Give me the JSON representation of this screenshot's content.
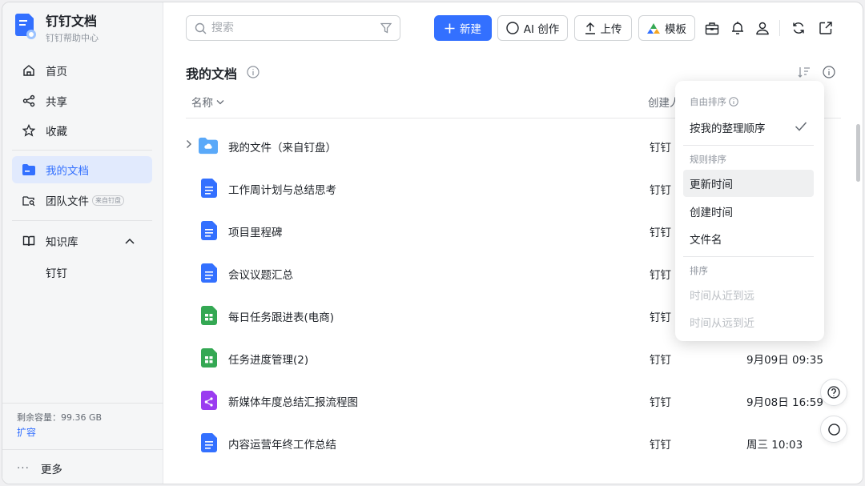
{
  "brand": {
    "title": "钉钉文档",
    "subtitle": "钉钉帮助中心"
  },
  "sidebar": {
    "items": [
      {
        "label": "首页",
        "icon": "home-icon"
      },
      {
        "label": "共享",
        "icon": "share-icon"
      },
      {
        "label": "收藏",
        "icon": "star-icon"
      },
      {
        "label": "我的文档",
        "icon": "folder-icon",
        "active": true
      },
      {
        "label": "团队文件",
        "icon": "team-folder-icon",
        "tag": "来自钉盘"
      },
      {
        "label": "知识库",
        "icon": "book-icon"
      }
    ],
    "knowledge_sub": "钉钉",
    "storage": "剩余容量：99.36 GB",
    "expand": "扩容",
    "more": "更多"
  },
  "toolbar": {
    "search_placeholder": "搜索",
    "new_label": "新建",
    "ai_label": "AI 创作",
    "upload_label": "上传",
    "template_label": "模板"
  },
  "main": {
    "title": "我的文档",
    "columns": {
      "name": "名称",
      "creator": "创建人"
    },
    "rows": [
      {
        "name": "我的文件（来自钉盘）",
        "type": "folder",
        "creator": "钉钉",
        "time": ""
      },
      {
        "name": "工作周计划与总结思考",
        "type": "doc",
        "creator": "钉钉",
        "time": ""
      },
      {
        "name": "项目里程碑",
        "type": "doc",
        "creator": "钉钉",
        "time": ""
      },
      {
        "name": "会议议题汇总",
        "type": "doc",
        "creator": "钉钉",
        "time": ""
      },
      {
        "name": "每日任务跟进表(电商)",
        "type": "sheet",
        "creator": "钉钉",
        "time": ""
      },
      {
        "name": "任务进度管理(2)",
        "type": "sheet",
        "creator": "钉钉",
        "time": "9月09日 09:35"
      },
      {
        "name": "新媒体年度总结汇报流程图",
        "type": "mindmap",
        "creator": "钉钉",
        "time": "9月08日 16:59"
      },
      {
        "name": "内容运营年终工作总结",
        "type": "doc",
        "creator": "钉钉",
        "time": "周三 10:03"
      }
    ]
  },
  "sort_menu": {
    "section_free": "自由排序",
    "item_my_order": "按我的整理顺序",
    "section_rule": "规则排序",
    "item_update_time": "更新时间",
    "item_create_time": "创建时间",
    "item_file_name": "文件名",
    "section_order": "排序",
    "item_near_to_far": "时间从近到远",
    "item_far_to_near": "时间从远到近"
  },
  "colors": {
    "accent": "#3370ff",
    "doc": "#3370ff",
    "sheet": "#34a853",
    "mindmap": "#9b3cf0",
    "folder": "#5aa9f9"
  }
}
